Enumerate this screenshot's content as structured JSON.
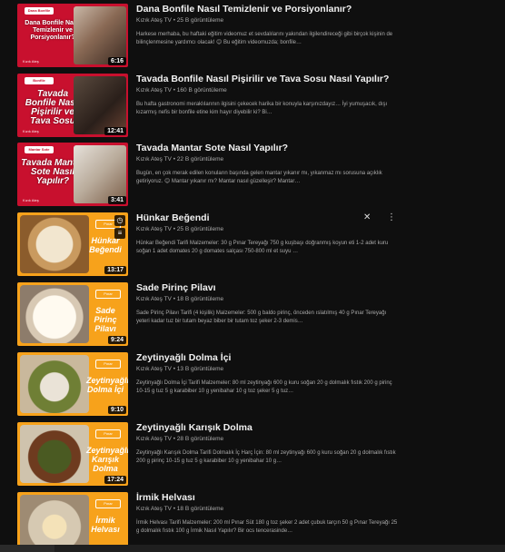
{
  "videos": [
    {
      "title": "Dana Bonfile Nasıl Temizlenir ve Porsiyonlanır?",
      "channel": "Kızık Ateş TV",
      "views": "25 B görüntüleme",
      "description": "Harkese merhaba, bu haftaki eğitim videomuz et sevdalılarını yakından ilgilendireceği gibi birçok kişinin de bilinçlenmesine yardımcı olacak! 😊 Bu eğitim videomuzda; bonfile…",
      "duration": "6:16",
      "thumb_text": "Dana Bonfile Nasıl Temizlenir ve Porsiyonlanır?",
      "thumb_tag": "Dana Bonfile",
      "thumb_brand": "Kızık Ateş",
      "style": "red",
      "photo": ""
    },
    {
      "title": "Tavada Bonfile Nasıl Pişirilir ve Tava Sosu Nasıl Yapılır?",
      "channel": "Kızık Ateş TV",
      "views": "160 B görüntüleme",
      "description": "Bu hafta gastronomi meraklılarının ilgisini çekecek harika bir konuyla karşınızdayız… İyi yumuşacık, dışı kızarmış nefis bir bonfile etine kim hayır diyebilir ki? Bi…",
      "duration": "12:41",
      "thumb_text": "Tavada Bonfile Nasıl Pişirilir ve Tava Sosu",
      "thumb_tag": "Bonfile",
      "thumb_brand": "Kızık Ateş",
      "style": "red",
      "photo": "dark"
    },
    {
      "title": "Tavada Mantar Sote Nasıl Yapılır?",
      "channel": "Kızık Ateş TV",
      "views": "22 B görüntüleme",
      "description": "Bugün, en çok merak edilen konuların başında gelen mantar yıkanır mı, yıkanmaz mı sorusuna açıklık getiriyoruz. 😊 Mantar yıkanır mı? Mantar nasıl güzelleşir? Mantar…",
      "duration": "3:41",
      "thumb_text": "Tavada Mantar Sote Nasıl Yapılır?",
      "thumb_tag": "Mantar Sote",
      "thumb_brand": "Kızık Ateş",
      "style": "red",
      "photo": "light"
    },
    {
      "title": "Hünkar Beğendi",
      "channel": "Kızık Ateş TV",
      "views": "25 B görüntüleme",
      "description": "Hünkar Beğendi Tarifi Malzemeler: 30 g Pınar Tereyağı 750 g kuşbaşı doğranmış koyun eti 1-2 adet kuru soğan 1 adet domates 20 g domates salçası 750-800 ml et suyu …",
      "duration": "13:17",
      "thumb_text": "Hünkar Beğendi",
      "thumb_tag": "Pınar",
      "thumb_brand": "",
      "style": "orange",
      "photo": ""
    },
    {
      "title": "Sade Pirinç Pilavı",
      "channel": "Kızık Ateş TV",
      "views": "18 B görüntüleme",
      "description": "Sade Pirinç Pilavı Tarifi (4 kişilik) Malzemeler: 500 g baldo pirinç, önceden ıslatılmış 40 g Pınar Tereyağı yeteri kadar tuz bir tutam beyaz biber bir tutam toz şeker 2-3 demis…",
      "duration": "9:24",
      "thumb_text": "Sade Pirinç Pilavı",
      "thumb_tag": "Pınar",
      "thumb_brand": "",
      "style": "orange",
      "photo": "pirinc"
    },
    {
      "title": "Zeytinyağlı Dolma İçi",
      "channel": "Kızık Ateş TV",
      "views": "13 B görüntüleme",
      "description": "Zeytinyağlı Dolma İçi Tarifi Malzemeler: 80 ml zeytinyağı 600 g kuru soğan 20 g dolmalık fıstık 200 g pirinç 10-15 g tuz 5 g karabiber 10 g yenibahar 10 g toz şeker 5 g tuz…",
      "duration": "9:10",
      "thumb_text": "Zeytinyağlı Dolma İçi",
      "thumb_tag": "Pınar",
      "thumb_brand": "",
      "style": "orange",
      "photo": "dolma"
    },
    {
      "title": "Zeytinyağlı Karışık Dolma",
      "channel": "Kızık Ateş TV",
      "views": "28 B görüntüleme",
      "description": "Zeytinyağlı Karışık Dolma Tarifi Dolmalık İç Harç İçin: 80 ml zeytinyağı 600 g kuru soğan 20 g dolmalık fıstık 200 g pirinç 10-15 g tuz 5 g karabiber 10 g yenibahar 10 g…",
      "duration": "17:24",
      "thumb_text": "Zeytinyağlı Karışık Dolma",
      "thumb_tag": "Pınar",
      "thumb_brand": "",
      "style": "orange",
      "photo": "karisik"
    },
    {
      "title": "İrmik Helvası",
      "channel": "Kızık Ateş TV",
      "views": "18 B görüntüleme",
      "description": "İrmik Helvası Tarifi Malzemeler: 200 ml Pınar Süt 180 g toz şeker 2 adet çubuk tarçın 50 g Pınar Tereyağı 25 g dolmalık fıstık 100 g İrmik Nasıl Yapılır? Bir ocs tencerasinde…",
      "duration": "",
      "thumb_text": "İrmik Helvası",
      "thumb_tag": "Pınar",
      "thumb_brand": "",
      "style": "orange",
      "photo": "helva"
    }
  ],
  "hover_actions": {
    "close_glyph": "✕",
    "more_glyph": "⋮",
    "queue_glyph": "≡"
  }
}
